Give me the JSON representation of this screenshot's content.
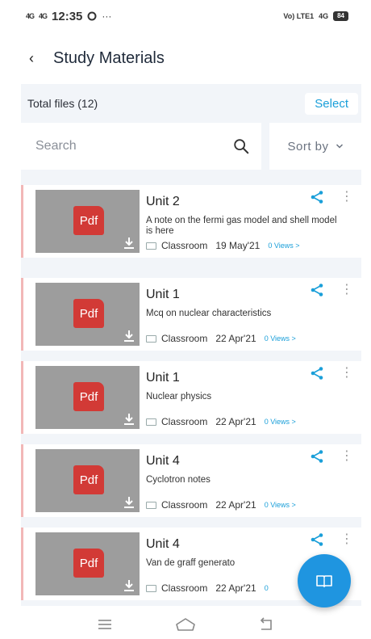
{
  "status_bar": {
    "signal_1": "4G",
    "signal_2": "4G",
    "time": "12:35",
    "dots": "···",
    "right_net": "Vo) LTE1",
    "right_4g": "4G",
    "battery": "84"
  },
  "header": {
    "back_icon": "‹",
    "title": "Study Materials"
  },
  "toolbar": {
    "total_files": "Total files (12)",
    "select_label": "Select"
  },
  "search": {
    "placeholder": "Search",
    "sort_label": "Sort by"
  },
  "materials": [
    {
      "title": "Unit 2",
      "description": "A note on the fermi gas model and shell model is here",
      "source": "Classroom",
      "date": "19 May'21",
      "views": "0 Views >",
      "badge": "Pdf"
    },
    {
      "title": "Unit 1",
      "description": "Mcq on nuclear characteristics",
      "source": "Classroom",
      "date": "22 Apr'21",
      "views": "0 Views >",
      "badge": "Pdf"
    },
    {
      "title": "Unit 1",
      "description": "Nuclear physics",
      "source": "Classroom",
      "date": "22 Apr'21",
      "views": "0 Views >",
      "badge": "Pdf"
    },
    {
      "title": "Unit 4",
      "description": "Cyclotron notes",
      "source": "Classroom",
      "date": "22 Apr'21",
      "views": "0 Views >",
      "badge": "Pdf"
    },
    {
      "title": "Unit 4",
      "description": "Van de graff generato",
      "source": "Classroom",
      "date": "22 Apr'21",
      "views": "0",
      "badge": "Pdf"
    }
  ],
  "colors": {
    "accent": "#1a9fd9",
    "fab": "#1f95e0",
    "pdf_red": "#d23a36",
    "thumb_gray": "#9d9d9d",
    "card_stripe": "#f2b7b7"
  },
  "icons": {
    "fab": "book-icon",
    "share": "share-icon",
    "more": "more-vertical-icon",
    "download": "download-icon",
    "search": "search-icon",
    "nav": [
      "menu-icon",
      "home-icon",
      "back-nav-icon"
    ]
  }
}
